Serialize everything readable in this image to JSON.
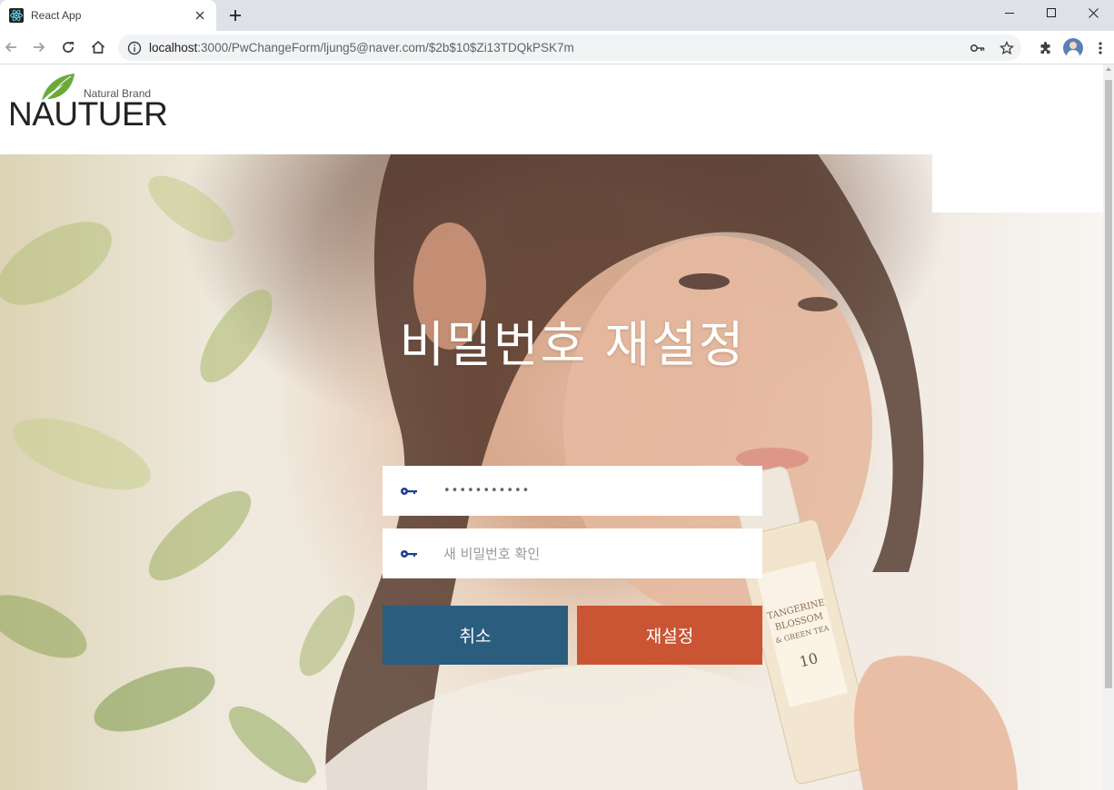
{
  "browser": {
    "tab_title": "React App",
    "url_host": "localhost",
    "url_rest": ":3000/PwChangeForm/ljung5@naver.com/$2b$10$Zi13TDQkPSK7m"
  },
  "logo": {
    "tagline": "Natural Brand",
    "name": "NAUTUER",
    "leaf_color": "#6aaa3a"
  },
  "form": {
    "title": "비밀번호 재설정",
    "new_password_value": "•••••••••••",
    "confirm_placeholder": "새 비밀번호 확인",
    "cancel_label": "취소",
    "reset_label": "재설정"
  },
  "colors": {
    "cancel_button": "#2b5d7f",
    "reset_button": "#c95535",
    "key_icon": "#1f3f8f"
  }
}
